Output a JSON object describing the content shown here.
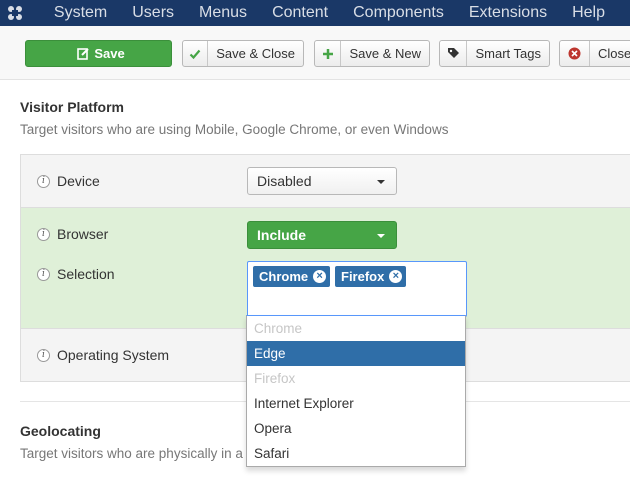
{
  "menu": [
    "System",
    "Users",
    "Menus",
    "Content",
    "Components",
    "Extensions",
    "Help"
  ],
  "toolbar": {
    "save": "Save",
    "save_close": "Save & Close",
    "save_new": "Save & New",
    "smart_tags": "Smart Tags",
    "close": "Close"
  },
  "visitor_platform": {
    "title": "Visitor Platform",
    "description": "Target visitors who are using Mobile, Google Chrome, or even Windows"
  },
  "fields": {
    "device": {
      "label": "Device",
      "value": "Disabled"
    },
    "browser": {
      "label": "Browser",
      "value": "Include"
    },
    "selection": {
      "label": "Selection",
      "chips": [
        "Chrome",
        "Firefox"
      ]
    },
    "operating_system": {
      "label": "Operating System"
    }
  },
  "dropdown": {
    "options": [
      {
        "label": "Chrome",
        "state": "disabled"
      },
      {
        "label": "Edge",
        "state": "highlighted"
      },
      {
        "label": "Firefox",
        "state": "disabled"
      },
      {
        "label": "Internet Explorer",
        "state": "normal"
      },
      {
        "label": "Opera",
        "state": "normal"
      },
      {
        "label": "Safari",
        "state": "normal"
      }
    ]
  },
  "geolocating": {
    "title": "Geolocating",
    "description": "Target visitors who are physically in a s"
  },
  "colors": {
    "topbar": "#1a3867",
    "success": "#46a546",
    "highlight": "#2f6ea8",
    "row_selected": "#dff0d8"
  }
}
